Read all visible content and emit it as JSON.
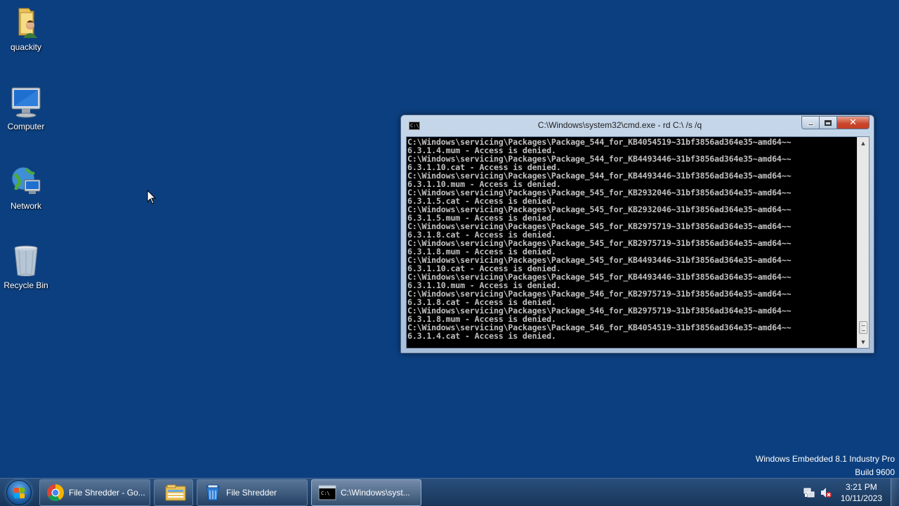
{
  "desktop": {
    "background_color": "#0c3f7f",
    "icons": [
      {
        "label": "quackity",
        "icon": "user-folder-icon"
      },
      {
        "label": "Computer",
        "icon": "computer-icon"
      },
      {
        "label": "Network",
        "icon": "network-icon"
      },
      {
        "label": "Recycle Bin",
        "icon": "recycle-bin-icon"
      }
    ],
    "watermark": {
      "line1": "Windows Embedded 8.1 Industry Pro",
      "line2": "Build 9600"
    }
  },
  "cmd_window": {
    "title": "C:\\Windows\\system32\\cmd.exe - rd  C:\\ /s /q",
    "icon_text": "C:\\",
    "close_glyph": "✕",
    "lines": [
      "C:\\Windows\\servicing\\Packages\\Package_544_for_KB4054519~31bf3856ad364e35~amd64~~",
      "6.3.1.4.mum - Access is denied.",
      "C:\\Windows\\servicing\\Packages\\Package_544_for_KB4493446~31bf3856ad364e35~amd64~~",
      "6.3.1.10.cat - Access is denied.",
      "C:\\Windows\\servicing\\Packages\\Package_544_for_KB4493446~31bf3856ad364e35~amd64~~",
      "6.3.1.10.mum - Access is denied.",
      "C:\\Windows\\servicing\\Packages\\Package_545_for_KB2932046~31bf3856ad364e35~amd64~~",
      "6.3.1.5.cat - Access is denied.",
      "C:\\Windows\\servicing\\Packages\\Package_545_for_KB2932046~31bf3856ad364e35~amd64~~",
      "6.3.1.5.mum - Access is denied.",
      "C:\\Windows\\servicing\\Packages\\Package_545_for_KB2975719~31bf3856ad364e35~amd64~~",
      "6.3.1.8.cat - Access is denied.",
      "C:\\Windows\\servicing\\Packages\\Package_545_for_KB2975719~31bf3856ad364e35~amd64~~",
      "6.3.1.8.mum - Access is denied.",
      "C:\\Windows\\servicing\\Packages\\Package_545_for_KB4493446~31bf3856ad364e35~amd64~~",
      "6.3.1.10.cat - Access is denied.",
      "C:\\Windows\\servicing\\Packages\\Package_545_for_KB4493446~31bf3856ad364e35~amd64~~",
      "6.3.1.10.mum - Access is denied.",
      "C:\\Windows\\servicing\\Packages\\Package_546_for_KB2975719~31bf3856ad364e35~amd64~~",
      "6.3.1.8.cat - Access is denied.",
      "C:\\Windows\\servicing\\Packages\\Package_546_for_KB2975719~31bf3856ad364e35~amd64~~",
      "6.3.1.8.mum - Access is denied.",
      "C:\\Windows\\servicing\\Packages\\Package_546_for_KB4054519~31bf3856ad364e35~amd64~~",
      "6.3.1.4.cat - Access is denied."
    ]
  },
  "taskbar": {
    "start_icon": "windows-start-orb-icon",
    "buttons": [
      {
        "label": "File Shredder - Go...",
        "icon": "chrome-icon"
      },
      {
        "label": "",
        "icon": "file-explorer-icon"
      },
      {
        "label": "File Shredder",
        "icon": "file-shredder-icon"
      },
      {
        "label": "C:\\Windows\\syst...",
        "icon": "cmd-icon",
        "active": true
      }
    ],
    "tray": {
      "icons": [
        "network-tray-icon",
        "volume-muted-icon"
      ],
      "time": "3:21 PM",
      "date": "10/11/2023"
    }
  }
}
